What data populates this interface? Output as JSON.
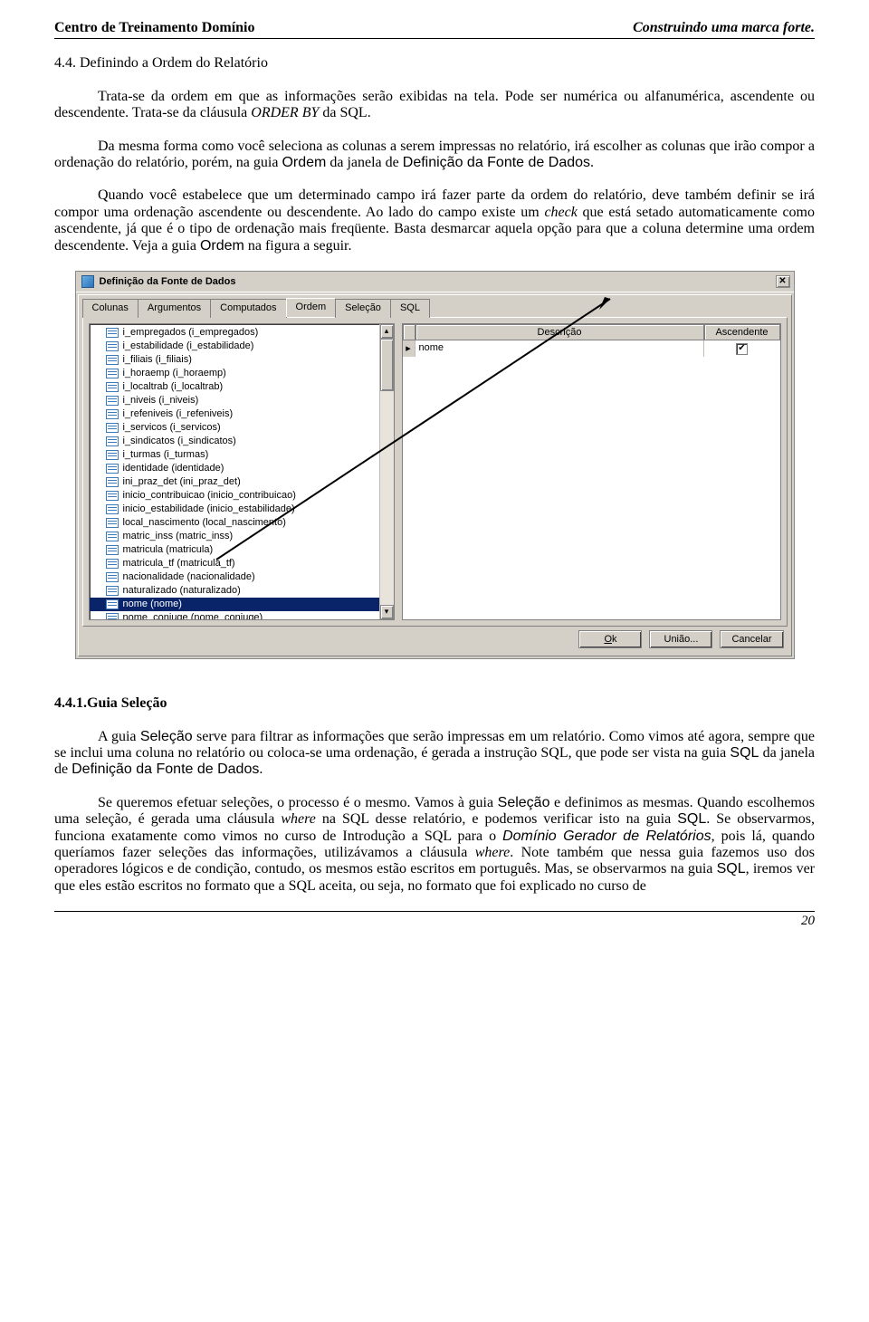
{
  "header": {
    "left": "Centro de Treinamento Domínio",
    "right": "Construindo uma marca forte."
  },
  "section1": {
    "title": "4.4. Definindo a Ordem do Relatório",
    "p1_a": "Trata-se da ordem em que as informações serão exibidas na tela. Pode ser numérica ou alfanumérica, ascendente ou descendente. Trata-se da cláusula ",
    "p1_i": "ORDER BY",
    "p1_b": " da SQL.",
    "p2_a": "Da mesma forma como você seleciona as colunas a serem impressas no relatório, irá escolher as colunas que irão compor a ordenação do relatório, porém, na guia ",
    "p2_s1": "Ordem",
    "p2_b": " da janela de ",
    "p2_s2": "Definição da Fonte de Dados",
    "p2_c": ".",
    "p3_a": "Quando você estabelece que um determinado campo irá fazer parte da ordem do relatório, deve também definir se irá compor uma ordenação ascendente ou descendente. Ao lado do campo existe um ",
    "p3_i": "check",
    "p3_b": " que está setado automaticamente como ascendente, já que é o tipo de ordenação mais freqüente. Basta desmarcar aquela opção para que a coluna determine uma ordem descendente. Veja a guia ",
    "p3_s": "Ordem",
    "p3_c": " na figura a seguir."
  },
  "shot": {
    "title": "Definição da Fonte de Dados",
    "tabs": [
      "Colunas",
      "Argumentos",
      "Computados",
      "Ordem",
      "Seleção",
      "SQL"
    ],
    "activeTab": 3,
    "gridHeaders": {
      "desc": "Descrição",
      "asc": "Ascendente"
    },
    "gridRow": {
      "desc": "nome",
      "checked": true
    },
    "items": [
      "i_empregados (i_empregados)",
      "i_estabilidade (i_estabilidade)",
      "i_filiais (i_filiais)",
      "i_horaemp (i_horaemp)",
      "i_localtrab (i_localtrab)",
      "i_niveis (i_niveis)",
      "i_refeniveis (i_refeniveis)",
      "i_servicos (i_servicos)",
      "i_sindicatos (i_sindicatos)",
      "i_turmas (i_turmas)",
      "identidade (identidade)",
      "ini_praz_det (ini_praz_det)",
      "inicio_contribuicao (inicio_contribuicao)",
      "inicio_estabilidade (inicio_estabilidade)",
      "local_nascimento (local_nascimento)",
      "matric_inss (matric_inss)",
      "matricula (matricula)",
      "matricula_tf (matricula_tf)",
      "nacionalidade (nacionalidade)",
      "naturalizado (naturalizado)",
      "nome (nome)",
      "nome_conjuge (nome_conjuge)"
    ],
    "selectedIndex": 20,
    "buttons": {
      "ok": "Ok",
      "uniao": "União...",
      "cancel": "Cancelar"
    }
  },
  "section2": {
    "title": "4.4.1.Guia Seleção",
    "p1_a": "A guia ",
    "p1_s1": "Seleção",
    "p1_b": " serve para filtrar as informações que serão impressas em um relatório. Como vimos até agora, sempre que se inclui uma coluna no relatório ou coloca-se uma ordenação, é gerada a instrução SQL, que pode ser vista na guia ",
    "p1_s2": "SQL",
    "p1_c": " da janela de ",
    "p1_s3": "Definição da Fonte de Dados",
    "p1_d": ".",
    "p2_a": "Se queremos efetuar seleções, o processo é o mesmo. Vamos à guia ",
    "p2_s1": "Seleção",
    "p2_b": " e definimos as mesmas. Quando escolhemos uma seleção, é gerada uma cláusula ",
    "p2_i1": "where",
    "p2_c": " na SQL desse relatório, e podemos verificar isto na guia ",
    "p2_s2": "SQL",
    "p2_d": ". Se observarmos, funciona exatamente como vimos no curso de Introdução a SQL para o ",
    "p2_s3": "Domínio Gerador de Relatórios",
    "p2_e": ", pois lá, quando queríamos fazer seleções das informações, utilizávamos a cláusula ",
    "p2_i2": "where",
    "p2_f": ". Note também que nessa guia fazemos uso dos operadores lógicos e de condição, contudo, os mesmos estão escritos em português. Mas, se observarmos na guia ",
    "p2_s4": "SQL",
    "p2_g": ", iremos ver que eles estão escritos no formato que a SQL aceita, ou seja, no formato que foi explicado no curso de"
  },
  "pageNumber": "20"
}
